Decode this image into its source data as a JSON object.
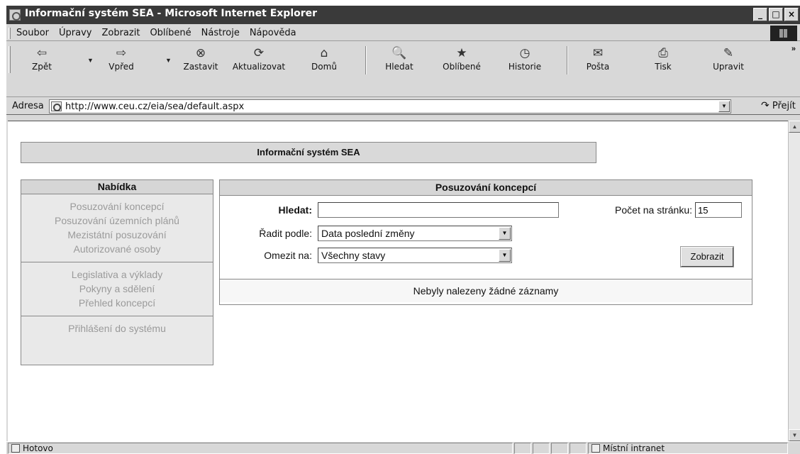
{
  "window": {
    "title": "Informační systém SEA - Microsoft Internet Explorer",
    "btn_min": "_",
    "btn_max": "□",
    "btn_close": "×"
  },
  "menu": [
    "Soubor",
    "Úpravy",
    "Zobrazit",
    "Oblíbené",
    "Nástroje",
    "Nápověda"
  ],
  "toolbar": {
    "back": {
      "label": "Zpět",
      "icon": "⇦"
    },
    "forward": {
      "label": "Vpřed",
      "icon": "⇨"
    },
    "stop": {
      "label": "Zastavit",
      "icon": "⊗"
    },
    "refresh": {
      "label": "Aktualizovat",
      "icon": "⟳"
    },
    "home": {
      "label": "Domů",
      "icon": "⌂"
    },
    "search": {
      "label": "Hledat",
      "icon": "🔍"
    },
    "favorites": {
      "label": "Oblíbené",
      "icon": "★"
    },
    "history": {
      "label": "Historie",
      "icon": "◷"
    },
    "mail": {
      "label": "Pošta",
      "icon": "✉"
    },
    "print": {
      "label": "Tisk",
      "icon": "⎙"
    },
    "edit": {
      "label": "Upravit",
      "icon": "✎"
    },
    "more": "»"
  },
  "address": {
    "label": "Adresa",
    "url": "http://www.ceu.cz/eia/sea/default.aspx",
    "go_label": "Přejít",
    "go_icon": "↷"
  },
  "page": {
    "header": "Informační systém SEA",
    "nav": {
      "title": "Nabídka",
      "groups": [
        [
          "Posuzování koncepcí",
          "Posuzování územních plánů",
          "Mezistátní posuzování",
          "Autorizované osoby"
        ],
        [
          "Legislativa a výklady",
          "Pokyny a sdělení",
          "Přehled koncepcí"
        ],
        [
          "Přihlášení do systému"
        ]
      ]
    },
    "main": {
      "title": "Posuzování koncepcí",
      "search_label": "Hledat:",
      "search_value": "",
      "per_page_label": "Počet na stránku:",
      "per_page_value": "15",
      "sort_label": "Řadit podle:",
      "sort_value": "Data poslední změny",
      "filter_label": "Omezit na:",
      "filter_value": "Všechny stavy",
      "show_button": "Zobrazit",
      "empty_message": "Nebyly nalezeny žádné záznamy"
    }
  },
  "status": {
    "left": "Hotovo",
    "zone": "Místní intranet"
  }
}
